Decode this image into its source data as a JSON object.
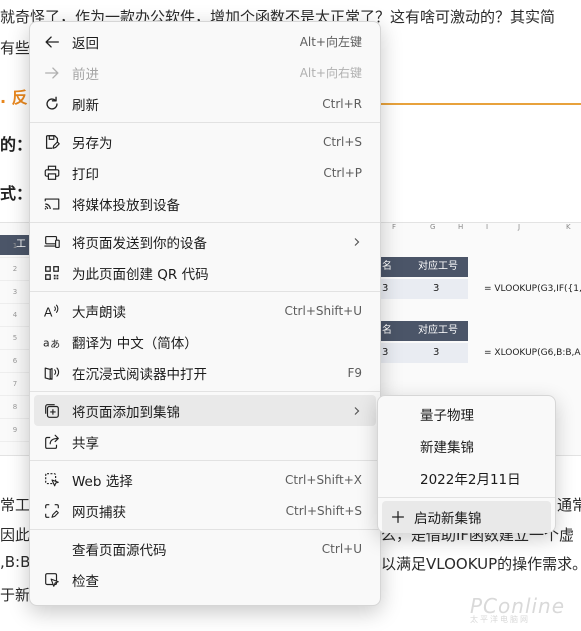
{
  "article": {
    "line1": "就奇怪了，作为一款办公软件，增加个函数不是太正常了？这有啥可激动的？其实简",
    "line2": "有些",
    "heading_suffix": ". 反",
    "label_a": "的：",
    "label_b": "式：",
    "para_line1_left": "常工",
    "para_line1_right": "通常",
    "para_line2_left": "因此",
    "para_line2_mid": "么，是借助IF函数建立一个虚",
    "para_line3_left": ",B:B",
    "para_line3_right": "以满足VLOOKUP的操作需求。",
    "para_line4_left": "于新"
  },
  "sheet": {
    "col_letters": [
      "F",
      "G",
      "H",
      "I",
      "J",
      "K"
    ],
    "row_numbers": [
      "1",
      "2",
      "3",
      "4",
      "5",
      "6",
      "7",
      "8",
      "9"
    ],
    "hdr_left": "工",
    "table1": {
      "col1": "名",
      "col2": "对应工号",
      "val1": "3",
      "val2": "3",
      "formula": "= VLOOKUP(G3,IF({1,0"
    },
    "table2": {
      "col1": "名",
      "col2": "对应工号",
      "val1": "3",
      "val2": "3",
      "formula": "= XLOOKUP(G6,B:B,A:"
    }
  },
  "watermark": {
    "brand": "PConline",
    "sub": "太平洋电脑网"
  },
  "menu": {
    "items": [
      {
        "label": "返回",
        "shortcut": "Alt+向左键",
        "icon": "arrow-left-icon"
      },
      {
        "label": "前进",
        "shortcut": "Alt+向右键",
        "icon": "arrow-right-icon",
        "disabled": true
      },
      {
        "label": "刷新",
        "shortcut": "Ctrl+R",
        "icon": "refresh-icon"
      },
      {
        "label": "另存为",
        "shortcut": "Ctrl+S",
        "icon": "save-as-icon"
      },
      {
        "label": "打印",
        "shortcut": "Ctrl+P",
        "icon": "printer-icon"
      },
      {
        "label": "将媒体投放到设备",
        "shortcut": "",
        "icon": "cast-icon"
      },
      {
        "label": "将页面发送到你的设备",
        "shortcut": "",
        "icon": "send-to-device-icon"
      },
      {
        "label": "为此页面创建 QR 代码",
        "shortcut": "",
        "icon": "qr-code-icon"
      },
      {
        "label": "大声朗读",
        "shortcut": "Ctrl+Shift+U",
        "icon": "read-aloud-icon"
      },
      {
        "label": "翻译为 中文（简体）",
        "shortcut": "",
        "icon": "translate-icon"
      },
      {
        "label": "在沉浸式阅读器中打开",
        "shortcut": "F9",
        "icon": "immersive-reader-icon"
      },
      {
        "label": "将页面添加到集锦",
        "shortcut": "",
        "icon": "collections-icon"
      },
      {
        "label": "共享",
        "shortcut": "",
        "icon": "share-icon"
      },
      {
        "label": "Web 选择",
        "shortcut": "Ctrl+Shift+X",
        "icon": "web-select-icon"
      },
      {
        "label": "网页捕获",
        "shortcut": "Ctrl+Shift+S",
        "icon": "web-capture-icon"
      },
      {
        "label": "查看页面源代码",
        "shortcut": "Ctrl+U",
        "icon": ""
      },
      {
        "label": "检查",
        "shortcut": "",
        "icon": "inspect-icon"
      }
    ]
  },
  "submenu": {
    "items": [
      "量子物理",
      "新建集锦",
      "2022年2月11日"
    ],
    "new_collection": "启动新集锦"
  }
}
